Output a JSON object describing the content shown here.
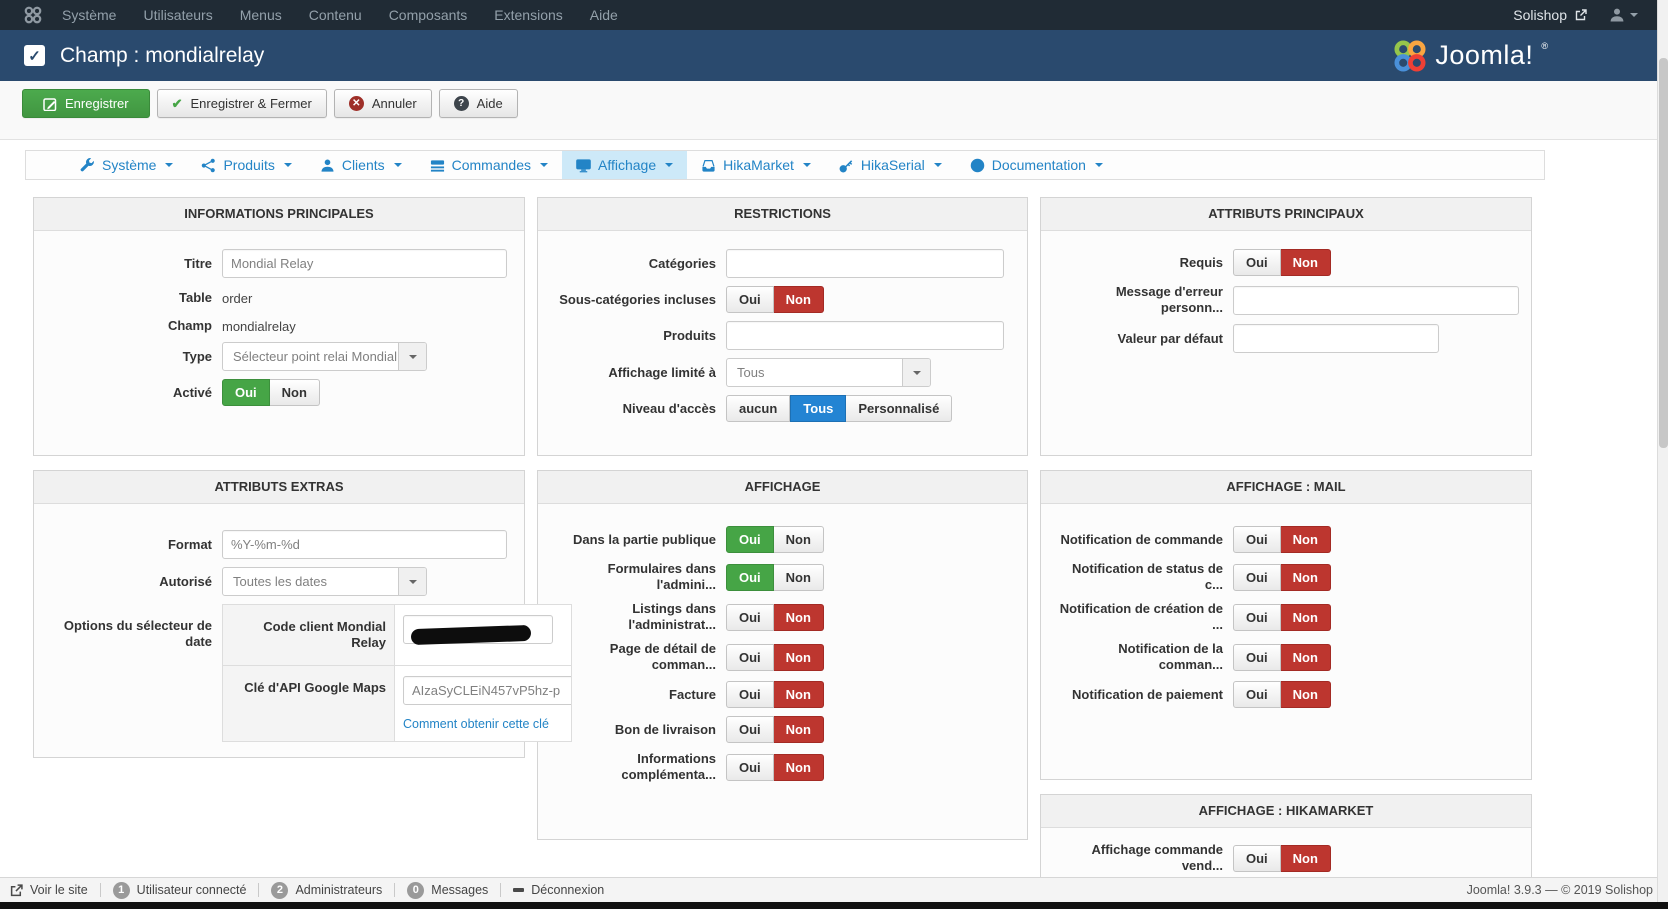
{
  "labels": {
    "yes": "Oui",
    "no": "Non"
  },
  "topbar": {
    "menu": [
      {
        "label": "Système"
      },
      {
        "label": "Utilisateurs"
      },
      {
        "label": "Menus"
      },
      {
        "label": "Contenu"
      },
      {
        "label": "Composants"
      },
      {
        "label": "Extensions"
      },
      {
        "label": "Aide"
      }
    ],
    "site_name": "Solishop"
  },
  "header": {
    "title": "Champ : mondialrelay",
    "logo": "Joomla!",
    "logo_reg": "®"
  },
  "toolbar": {
    "save": "Enregistrer",
    "save_close": "Enregistrer & Fermer",
    "cancel": "Annuler",
    "help": "Aide"
  },
  "tabs": [
    {
      "label": "Système"
    },
    {
      "label": "Produits"
    },
    {
      "label": "Clients"
    },
    {
      "label": "Commandes"
    },
    {
      "label": "Affichage"
    },
    {
      "label": "HikaMarket"
    },
    {
      "label": "HikaSerial"
    },
    {
      "label": "Documentation"
    }
  ],
  "panels": {
    "info": {
      "title": "INFORMATIONS PRINCIPALES",
      "titre": {
        "label": "Titre",
        "value": "Mondial Relay"
      },
      "table": {
        "label": "Table",
        "value": "order"
      },
      "champ": {
        "label": "Champ",
        "value": "mondialrelay"
      },
      "type": {
        "label": "Type",
        "value": "Sélecteur point relai Mondial ..."
      },
      "active": {
        "label": "Activé",
        "value": "oui"
      }
    },
    "restrictions": {
      "title": "RESTRICTIONS",
      "categories": {
        "label": "Catégories",
        "value": ""
      },
      "souscat": {
        "label": "Sous-catégories incluses",
        "value": "non"
      },
      "produits": {
        "label": "Produits",
        "value": ""
      },
      "limite": {
        "label": "Affichage limité à",
        "value": "Tous"
      },
      "acces": {
        "label": "Niveau d'accès",
        "value": "tous",
        "options": [
          "aucun",
          "Tous",
          "Personnalisé"
        ]
      }
    },
    "attr_main": {
      "title": "ATTRIBUTS PRINCIPAUX",
      "requis": {
        "label": "Requis",
        "value": "non"
      },
      "erreur": {
        "label": "Message d'erreur personn...",
        "value": ""
      },
      "defaut": {
        "label": "Valeur par défaut",
        "value": ""
      }
    },
    "attr_extra": {
      "title": "ATTRIBUTS EXTRAS",
      "format": {
        "label": "Format",
        "value": "%Y-%m-%d"
      },
      "autorise": {
        "label": "Autorisé",
        "value": "Toutes les dates"
      },
      "date_options": {
        "label": "Options du sélecteur de date",
        "rows": [
          {
            "label": "Code client Mondial Relay",
            "redacted": true
          },
          {
            "label": "Clé d'API Google Maps",
            "value": "AIzaSyCLEiN457vP5hz-p",
            "link": "Comment obtenir cette clé"
          }
        ]
      }
    },
    "affichage": {
      "title": "AFFICHAGE",
      "rows": [
        {
          "label": "Dans la partie publique",
          "value": "oui"
        },
        {
          "label": "Formulaires dans l'admini...",
          "value": "oui"
        },
        {
          "label": "Listings dans l'administrat...",
          "value": "non"
        },
        {
          "label": "Page de détail de comman...",
          "value": "non"
        },
        {
          "label": "Facture",
          "value": "non"
        },
        {
          "label": "Bon de livraison",
          "value": "non"
        },
        {
          "label": "Informations complémenta...",
          "value": "non"
        }
      ]
    },
    "mail": {
      "title": "AFFICHAGE : MAIL",
      "rows": [
        {
          "label": "Notification de commande",
          "value": "non"
        },
        {
          "label": "Notification de status de c...",
          "value": "non"
        },
        {
          "label": "Notification de création de ...",
          "value": "non"
        },
        {
          "label": "Notification de la comman...",
          "value": "non"
        },
        {
          "label": "Notification de paiement",
          "value": "non"
        }
      ]
    },
    "hikamarket": {
      "title": "AFFICHAGE : HIKAMARKET",
      "rows": [
        {
          "label": "Affichage commande vend...",
          "value": "non"
        }
      ]
    }
  },
  "statusbar": {
    "view_site": "Voir le site",
    "items": [
      {
        "count": "1",
        "label": "Utilisateur connecté"
      },
      {
        "count": "2",
        "label": "Administrateurs"
      },
      {
        "count": "0",
        "label": "Messages"
      }
    ],
    "logout": "Déconnexion",
    "footer": "Joomla! 3.9.3  —  © 2019 Solishop"
  }
}
